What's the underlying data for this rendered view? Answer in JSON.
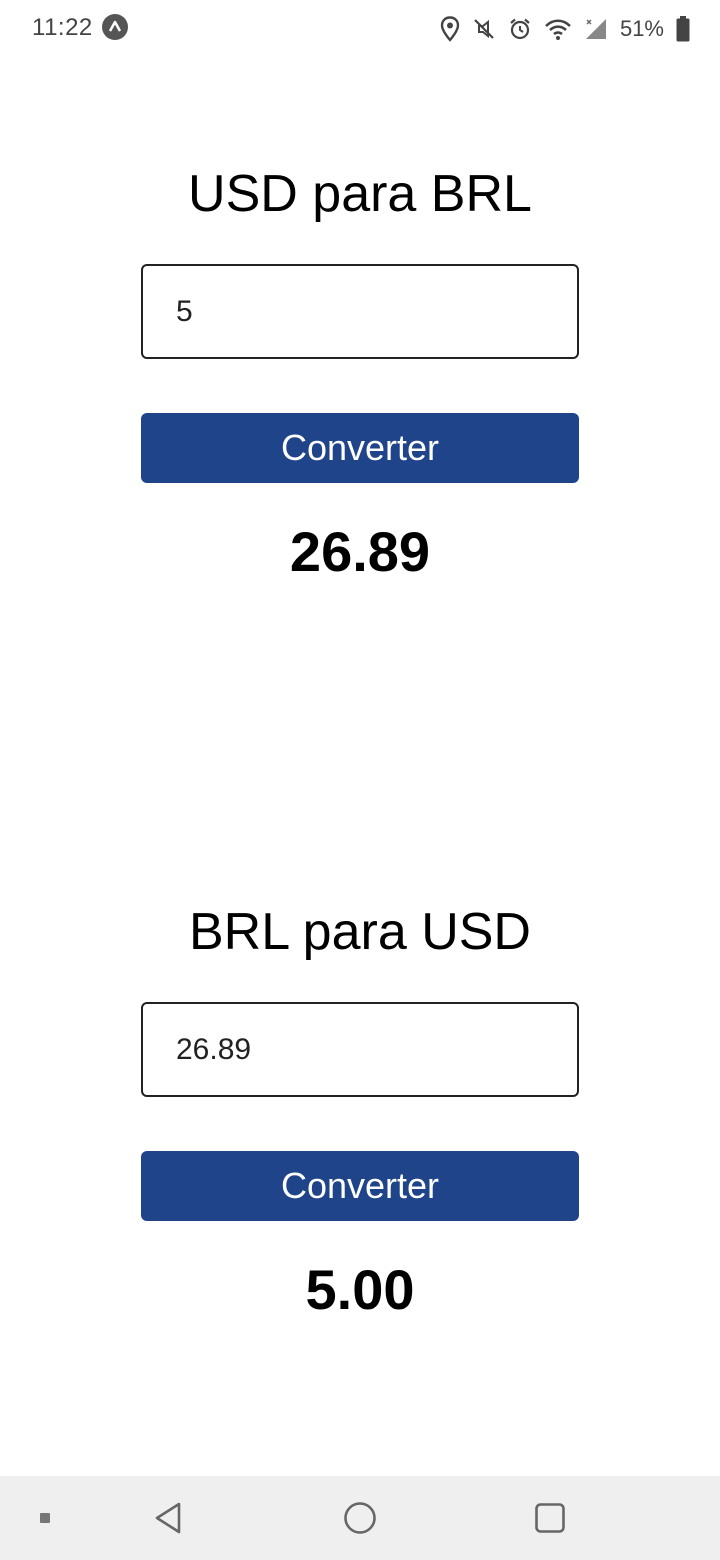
{
  "status_bar": {
    "time": "11:22",
    "battery_percent": "51%",
    "icons": [
      "app-icon",
      "location-icon",
      "mute-icon",
      "alarm-icon",
      "wifi-icon",
      "signal-icon",
      "battery-icon"
    ]
  },
  "converters": [
    {
      "title": "USD para BRL",
      "input_value": "5",
      "button_label": "Converter",
      "result": "26.89"
    },
    {
      "title": "BRL para USD",
      "input_value": "26.89",
      "button_label": "Converter",
      "result": "5.00"
    }
  ],
  "colors": {
    "button_background": "#1f4489",
    "button_text": "#ffffff",
    "nav_bar_background": "#efefef"
  },
  "nav_bar": {
    "icons": [
      "square-dot-icon",
      "back-icon",
      "home-icon",
      "recents-icon"
    ]
  }
}
